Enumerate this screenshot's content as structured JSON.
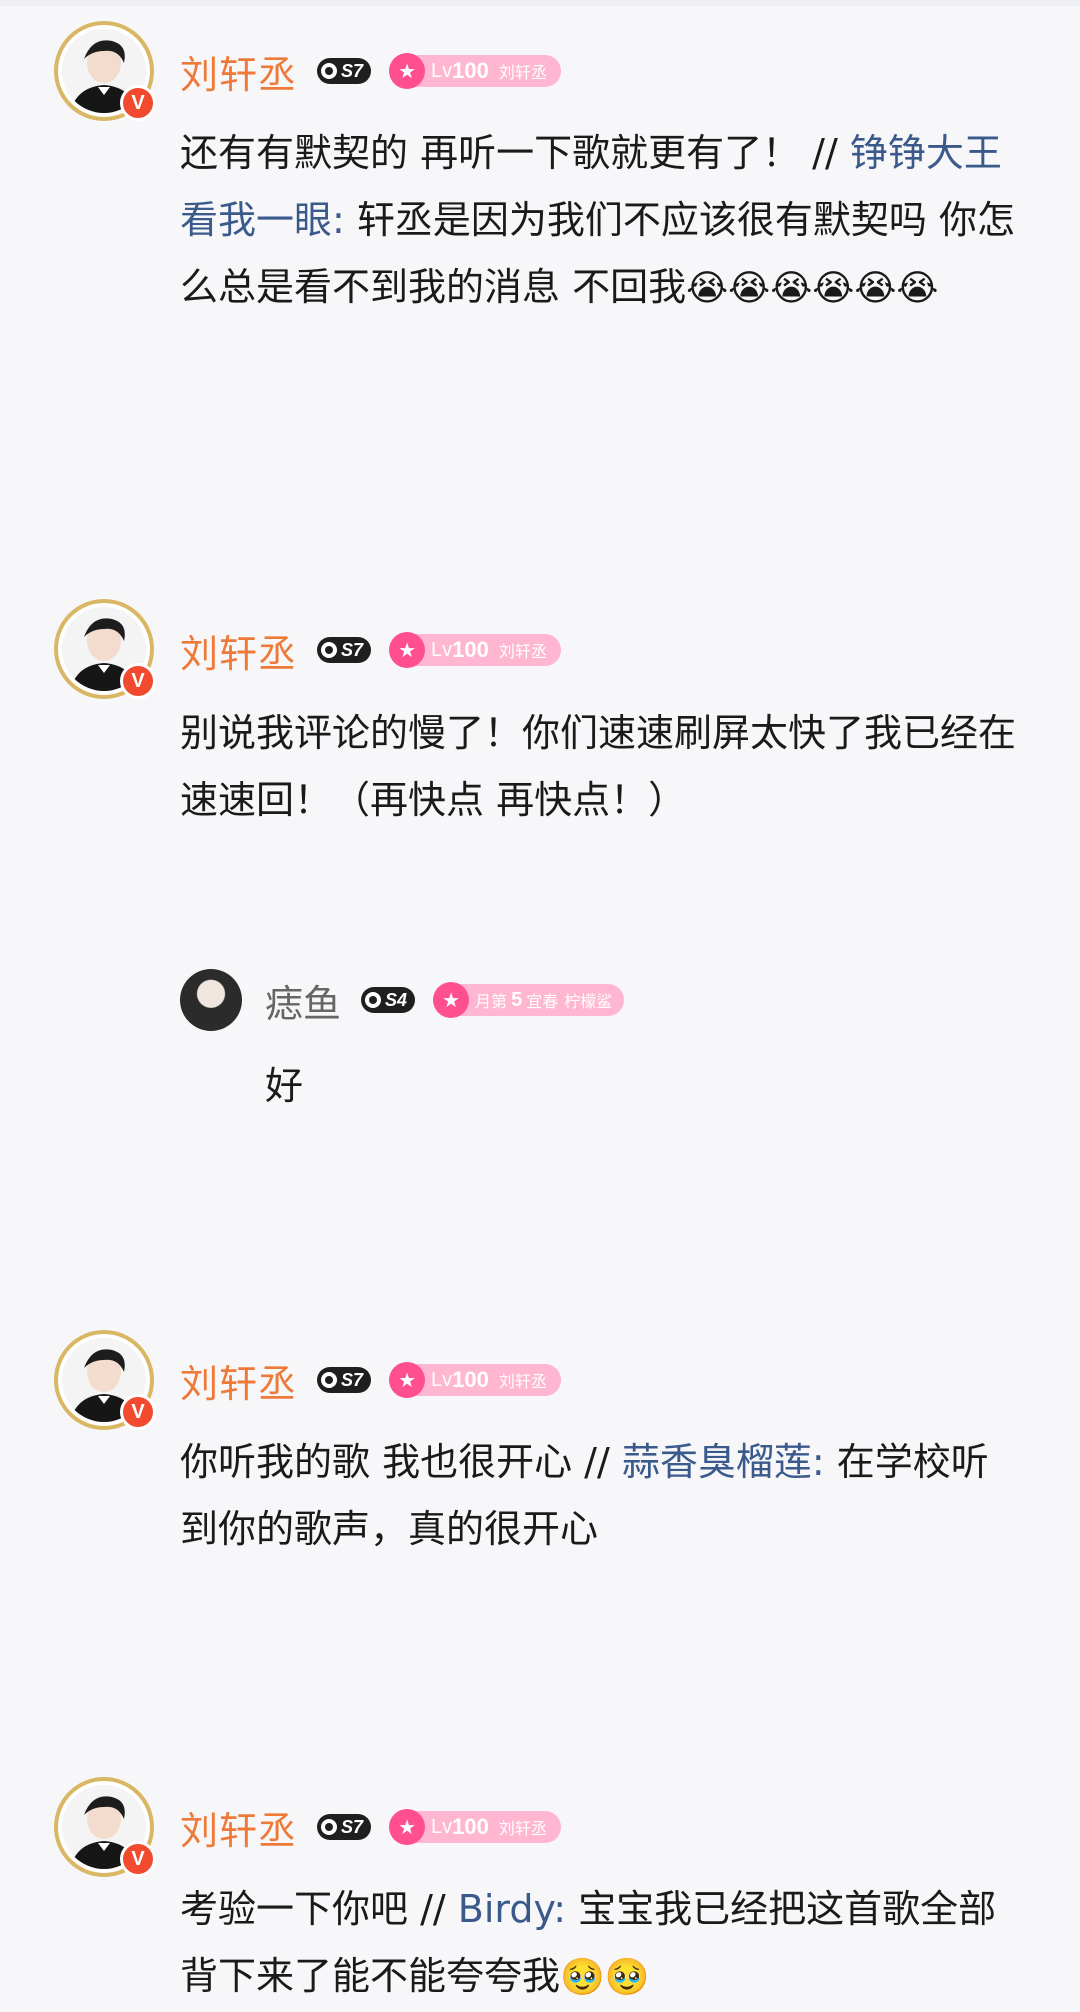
{
  "brand_colors": {
    "name": "#ee7a3a",
    "mention": "#3b5a8c",
    "verified": "#f24a2f",
    "fan_badge": "#ff4f8f"
  },
  "comments": [
    {
      "user": "刘轩丞",
      "s_level": "S7",
      "fan_level_prefix": "Lv",
      "fan_level": "100",
      "fan_tag": "刘轩丞",
      "text_before": "还有有默契的 再听一下歌就更有了！ // ",
      "mention": "铮铮大王看我一眼:",
      "text_after": " 轩丞是因为我们不应该很有默契吗 你怎么总是看不到我的消息 不回我",
      "emojis": "😭😭😭😭😭😭"
    },
    {
      "user": "刘轩丞",
      "s_level": "S7",
      "fan_level_prefix": "Lv",
      "fan_level": "100",
      "fan_tag": "刘轩丞",
      "text": "别说我评论的慢了！你们速速刷屏太快了我已经在速速回！（再快点 再快点！）",
      "reply": {
        "user": "痣鱼",
        "s_level": "S4",
        "badge_prefix": "月第",
        "badge_num": "5",
        "badge_text": "宜春",
        "badge_tag": "柠檬鲨",
        "text": "好"
      }
    },
    {
      "user": "刘轩丞",
      "s_level": "S7",
      "fan_level_prefix": "Lv",
      "fan_level": "100",
      "fan_tag": "刘轩丞",
      "text_before": "你听我的歌 我也很开心 // ",
      "mention": "蒜香臭榴莲:",
      "text_after": " 在学校听到你的歌声，真的很开心"
    },
    {
      "user": "刘轩丞",
      "s_level": "S7",
      "fan_level_prefix": "Lv",
      "fan_level": "100",
      "fan_tag": "刘轩丞",
      "text_before": "考验一下你吧 // ",
      "mention": "Birdy:",
      "text_after": " 宝宝我已经把这首歌全部背下来了能不能夸夸我",
      "emojis": "🥹🥹"
    }
  ]
}
